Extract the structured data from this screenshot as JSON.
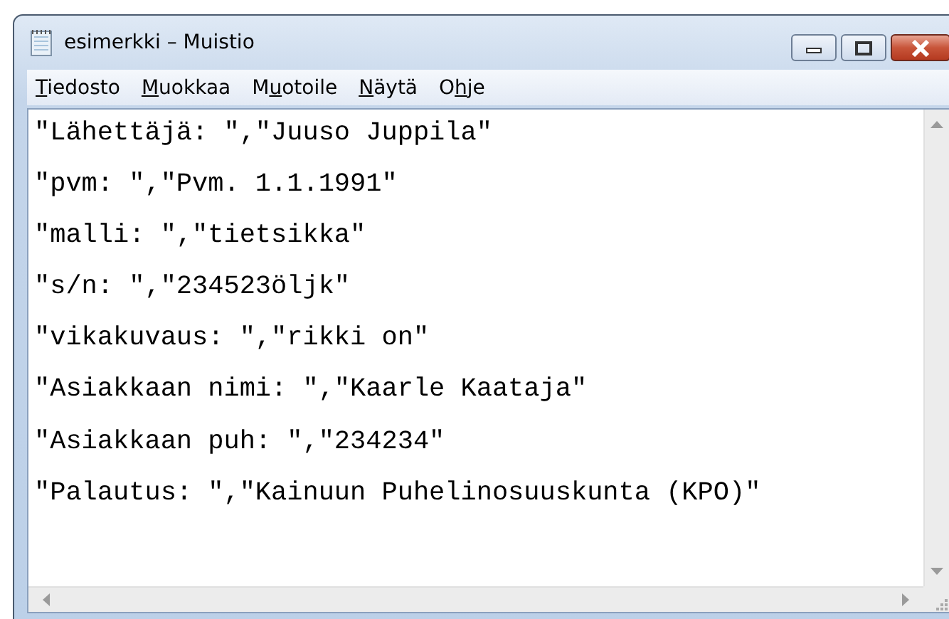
{
  "window": {
    "title": "esimerkki – Muistio"
  },
  "menu": [
    {
      "key": "T",
      "post": "iedosto"
    },
    {
      "key": "M",
      "post": "uokkaa"
    },
    {
      "pre": "M",
      "key": "u",
      "post": "otoile"
    },
    {
      "key": "N",
      "post": "äytä"
    },
    {
      "pre": "O",
      "key": "h",
      "post": "je"
    }
  ],
  "lines": [
    "\"Lähettäjä: \",\"Juuso Juppila\"",
    "\"pvm: \",\"Pvm. 1.1.1991\"",
    "\"malli: \",\"tietsikka\"",
    "\"s/n: \",\"234523öljk\"",
    "\"vikakuvaus: \",\"rikki on\"",
    "\"Asiakkaan nimi: \",\"Kaarle Kaataja\"",
    "\"Asiakkaan puh: \",\"234234\"",
    "\"Palautus: \",\"Kainuun Puhelinosuuskunta (KPO)\""
  ]
}
